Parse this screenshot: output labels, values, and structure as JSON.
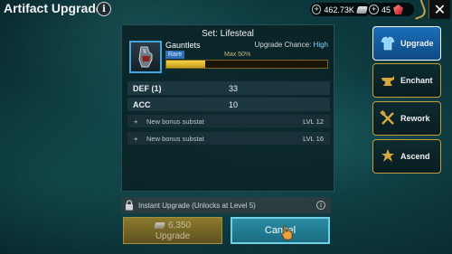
{
  "header": {
    "title": "Artifact Upgrade",
    "info_glyph": "i",
    "silver_amount": "462.73K",
    "gems_amount": "45",
    "close_glyph": "✕"
  },
  "panel": {
    "set_title": "Set: Lifesteal",
    "artifact_name": "Gauntlets",
    "rarity": "Rare",
    "upgrade_chance_label": "Upgrade Chance:",
    "upgrade_chance_value": "High",
    "max_label": "Max 50%",
    "progress_fraction": 0.24,
    "stats": [
      {
        "name": "DEF",
        "extra": "(1)",
        "value": "33"
      },
      {
        "name": "ACC",
        "extra": "",
        "value": "10"
      }
    ],
    "bonus": [
      {
        "plus": "+",
        "text": "New bonus substat",
        "level": "LVL 12"
      },
      {
        "plus": "+",
        "text": "New bonus substat",
        "level": "LVL 16"
      }
    ]
  },
  "instant": {
    "text": "Instant Upgrade (Unlocks at Level 5)",
    "info_glyph": "i"
  },
  "buttons": {
    "upgrade_cost": "6,350",
    "upgrade_label": "Upgrade",
    "cancel_label": "Cancel"
  },
  "tabs": [
    {
      "label": "Upgrade",
      "icon": "armor-icon",
      "active": true
    },
    {
      "label": "Enchant",
      "icon": "anvil-icon",
      "active": false
    },
    {
      "label": "Rework",
      "icon": "hammer-wrench-icon",
      "active": false
    },
    {
      "label": "Ascend",
      "icon": "ascend-icon",
      "active": false
    }
  ],
  "colors": {
    "accent": "#3fa6e0",
    "gold": "#c59b3c",
    "progress": "#f6d24a"
  }
}
